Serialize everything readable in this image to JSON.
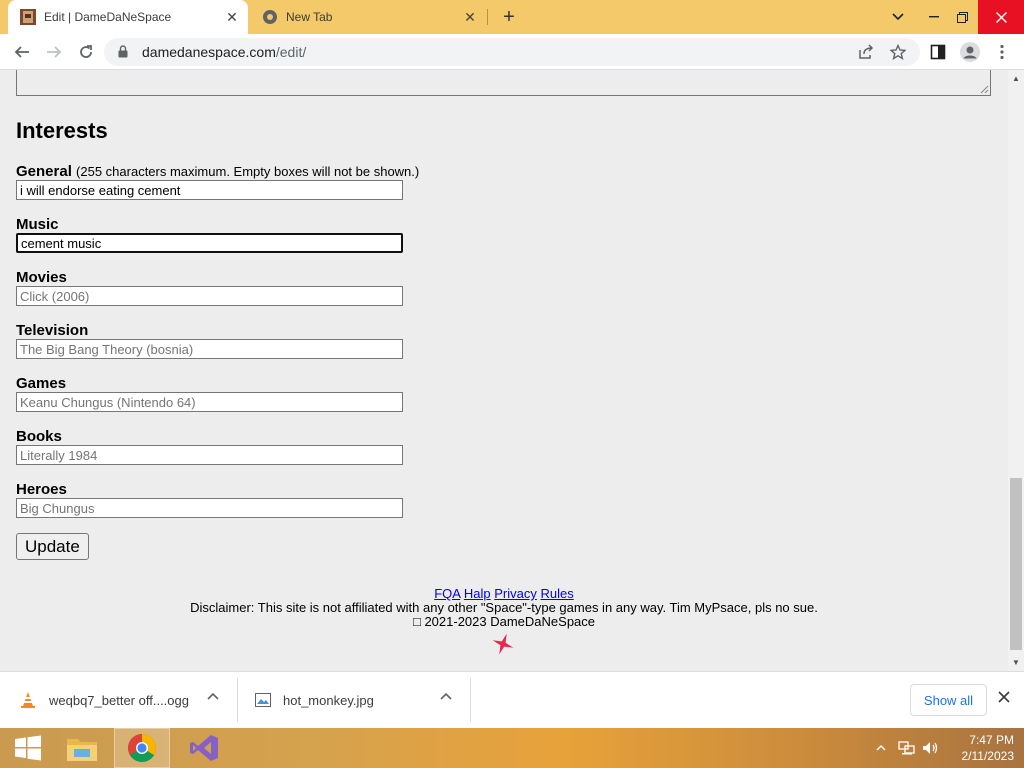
{
  "browser": {
    "tabs": [
      {
        "title": "Edit | DameDaNeSpace",
        "active": true
      },
      {
        "title": "New Tab",
        "active": false
      }
    ],
    "url_host": "damedanespace.com",
    "url_path": "/edit/"
  },
  "page": {
    "heading": "Interests",
    "note": "(255 characters maximum. Empty boxes will not be shown.)",
    "fields": [
      {
        "label": "General",
        "value": "i will endorse eating cement",
        "placeholder": ""
      },
      {
        "label": "Music",
        "value": "cement music",
        "placeholder": ""
      },
      {
        "label": "Movies",
        "value": "",
        "placeholder": "Click (2006)"
      },
      {
        "label": "Television",
        "value": "",
        "placeholder": "The Big Bang Theory (bosnia)"
      },
      {
        "label": "Games",
        "value": "",
        "placeholder": "Keanu Chungus (Nintendo 64)"
      },
      {
        "label": "Books",
        "value": "",
        "placeholder": "Literally 1984"
      },
      {
        "label": "Heroes",
        "value": "",
        "placeholder": "Big Chungus"
      }
    ],
    "update_label": "Update",
    "footer": {
      "links": [
        "FQA",
        "Halp",
        "Privacy",
        "Rules"
      ],
      "disclaimer": "Disclaimer: This site is not affiliated with any other \"Space\"-type games in any way. Tim MyPsace, pls no sue.",
      "copyright": "□ 2021-2023 DameDaNeSpace"
    }
  },
  "downloads": {
    "items": [
      {
        "name": "weqbq7_better off....ogg",
        "icon": "vlc-cone-icon"
      },
      {
        "name": "hot_monkey.jpg",
        "icon": "image-file-icon"
      }
    ],
    "show_all_label": "Show all"
  },
  "taskbar": {
    "time": "7:47 PM",
    "date": "2/11/2023"
  },
  "colors": {
    "tabstrip": "#f3c969",
    "link": "#0000ee",
    "close_red": "#e81123"
  }
}
